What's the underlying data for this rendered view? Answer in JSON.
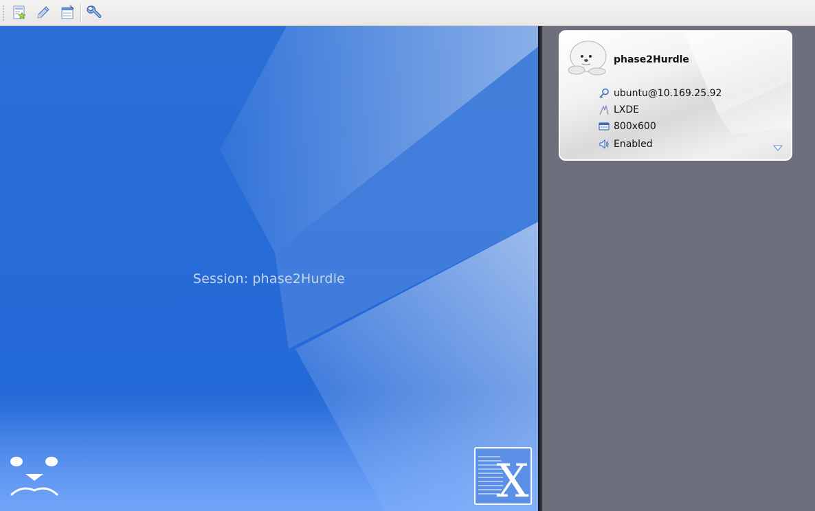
{
  "toolbar": {
    "buttons": [
      {
        "icon": "new-session-icon"
      },
      {
        "icon": "edit-session-icon"
      },
      {
        "icon": "manage-sessions-icon"
      },
      {
        "icon": "settings-wrench-icon"
      }
    ]
  },
  "session_view": {
    "label": "Session:",
    "name": "phase2Hurdle",
    "background_color": "#256fd8",
    "corner_logo_letter": "X"
  },
  "session_card": {
    "title": "phase2Hurdle",
    "rows": [
      {
        "icon": "key-icon",
        "text": "ubuntu@10.169.25.92"
      },
      {
        "icon": "desktop-environment-icon",
        "text": "LXDE"
      },
      {
        "icon": "display-resolution-icon",
        "text": "800x600"
      },
      {
        "icon": "speaker-icon",
        "text": "Enabled"
      }
    ]
  },
  "colors": {
    "panel_bg": "#6e6f7d",
    "toolbar_bg": "#f2f1f0",
    "accent": "#3b7bd8"
  }
}
